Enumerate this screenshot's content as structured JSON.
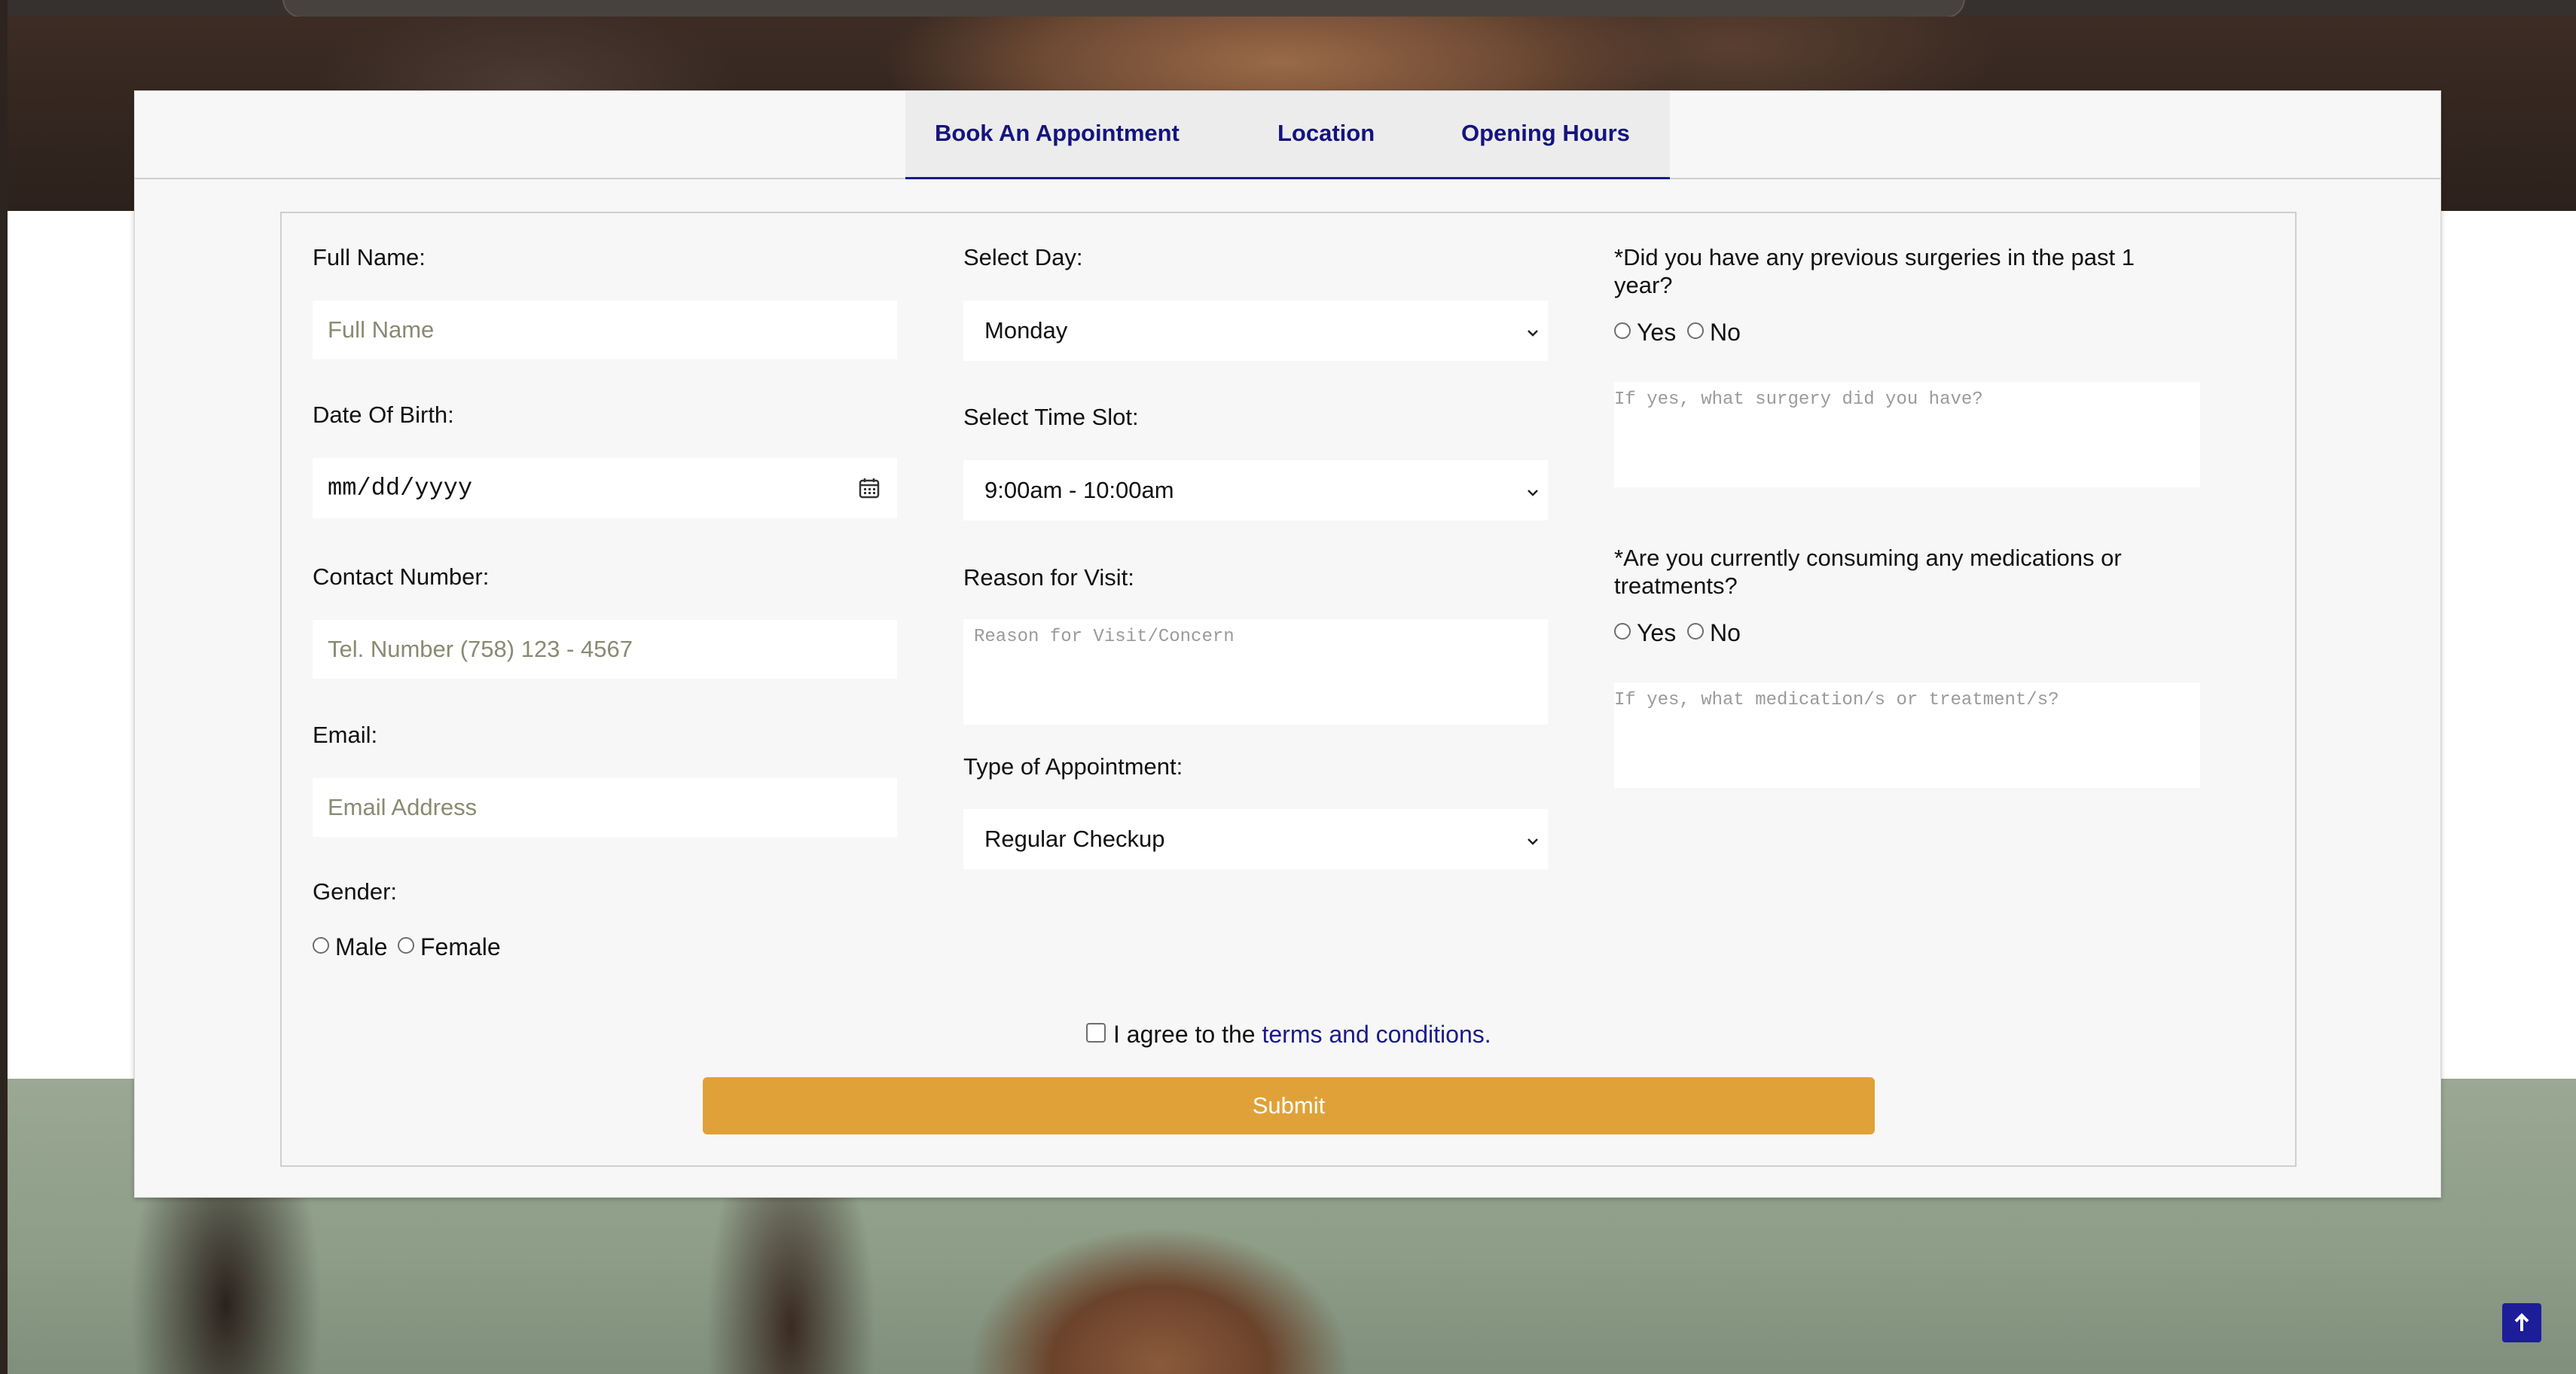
{
  "tabs": [
    {
      "label": "Book An Appointment",
      "active": true
    },
    {
      "label": "Location",
      "active": false
    },
    {
      "label": "Opening Hours",
      "active": false
    }
  ],
  "form": {
    "full_name": {
      "label": "Full Name:",
      "placeholder": "Full Name"
    },
    "date_of_birth": {
      "label": "Date Of Birth:",
      "placeholder": "mm/dd/yyyy"
    },
    "contact_number": {
      "label": "Contact Number:",
      "placeholder": "Tel. Number (758) 123 - 4567"
    },
    "email": {
      "label": "Email:",
      "placeholder": "Email Address"
    },
    "gender": {
      "label": "Gender:",
      "options": [
        "Male",
        "Female"
      ]
    },
    "select_day": {
      "label": "Select Day:",
      "value": "Monday"
    },
    "time_slot": {
      "label": "Select Time Slot:",
      "value": "9:00am - 10:00am"
    },
    "reason": {
      "label": "Reason for Visit:",
      "placeholder": "Reason for Visit/Concern"
    },
    "appointment_type": {
      "label": "Type of Appointment:",
      "value": "Regular Checkup"
    },
    "surgeries": {
      "question_line1": "*Did you have any previous surgeries in the past 1",
      "question_line2": "year?",
      "options": [
        "Yes",
        "No"
      ],
      "details_placeholder": "If yes, what surgery did you have?"
    },
    "medications": {
      "question_line1": "*Are you currently consuming any medications or",
      "question_line2": "treatments?",
      "options": [
        "Yes",
        "No"
      ],
      "details_placeholder": "If yes, what medication/s or treatment/s?"
    },
    "agree": {
      "prefix": "I agree to the ",
      "link_text": "terms and conditions."
    },
    "submit_label": "Submit"
  },
  "colors": {
    "accent": "#e0a238",
    "tab_text": "#14147e",
    "link": "#1a1a8c",
    "scroll_button": "#1d1d9a"
  },
  "icons": {
    "calendar": "calendar-icon",
    "chevron": "chevron-down-icon",
    "scroll_top": "arrow-up-icon"
  }
}
